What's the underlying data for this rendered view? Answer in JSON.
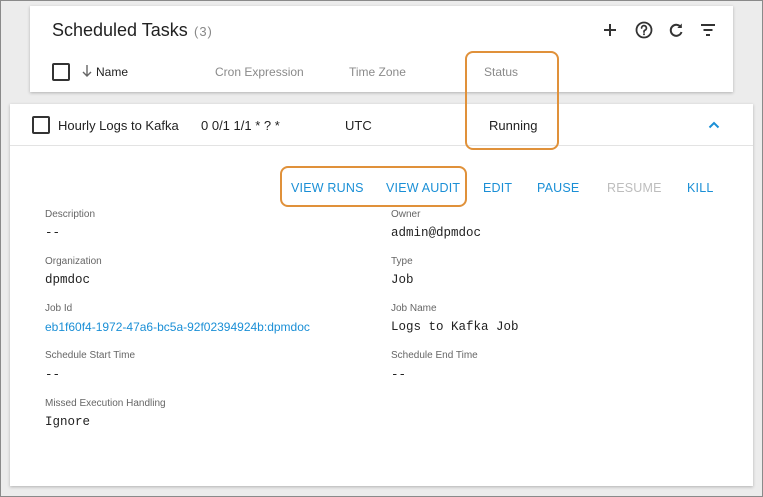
{
  "header": {
    "title": "Scheduled Tasks",
    "count": "(3)",
    "columns": {
      "name": "Name",
      "cron": "Cron Expression",
      "timezone": "Time Zone",
      "status": "Status"
    }
  },
  "task": {
    "name": "Hourly Logs to Kafka",
    "cron": "0 0/1 1/1 * ? *",
    "timezone": "UTC",
    "status": "Running"
  },
  "actions": {
    "view_runs": "VIEW RUNS",
    "view_audit": "VIEW AUDIT",
    "edit": "EDIT",
    "pause": "PAUSE",
    "resume": "RESUME",
    "kill": "KILL"
  },
  "details": {
    "description_label": "Description",
    "description_value": "--",
    "owner_label": "Owner",
    "owner_value": "admin@dpmdoc",
    "organization_label": "Organization",
    "organization_value": "dpmdoc",
    "type_label": "Type",
    "type_value": "Job",
    "job_id_label": "Job Id",
    "job_id_value": "eb1f60f4-1972-47a6-bc5a-92f02394924b:dpmdoc",
    "job_name_label": "Job Name",
    "job_name_value": "Logs to Kafka Job",
    "start_label": "Schedule Start Time",
    "start_value": "--",
    "end_label": "Schedule End Time",
    "end_value": "--",
    "missed_label": "Missed Execution Handling",
    "missed_value": "Ignore"
  },
  "colors": {
    "accent": "#1a8fd6",
    "highlight": "#e0913a",
    "disabled": "#bdbdbd"
  },
  "icons": [
    "plus-icon",
    "help-icon",
    "refresh-icon",
    "filter-icon",
    "sort-down-icon",
    "chevron-up-icon"
  ]
}
